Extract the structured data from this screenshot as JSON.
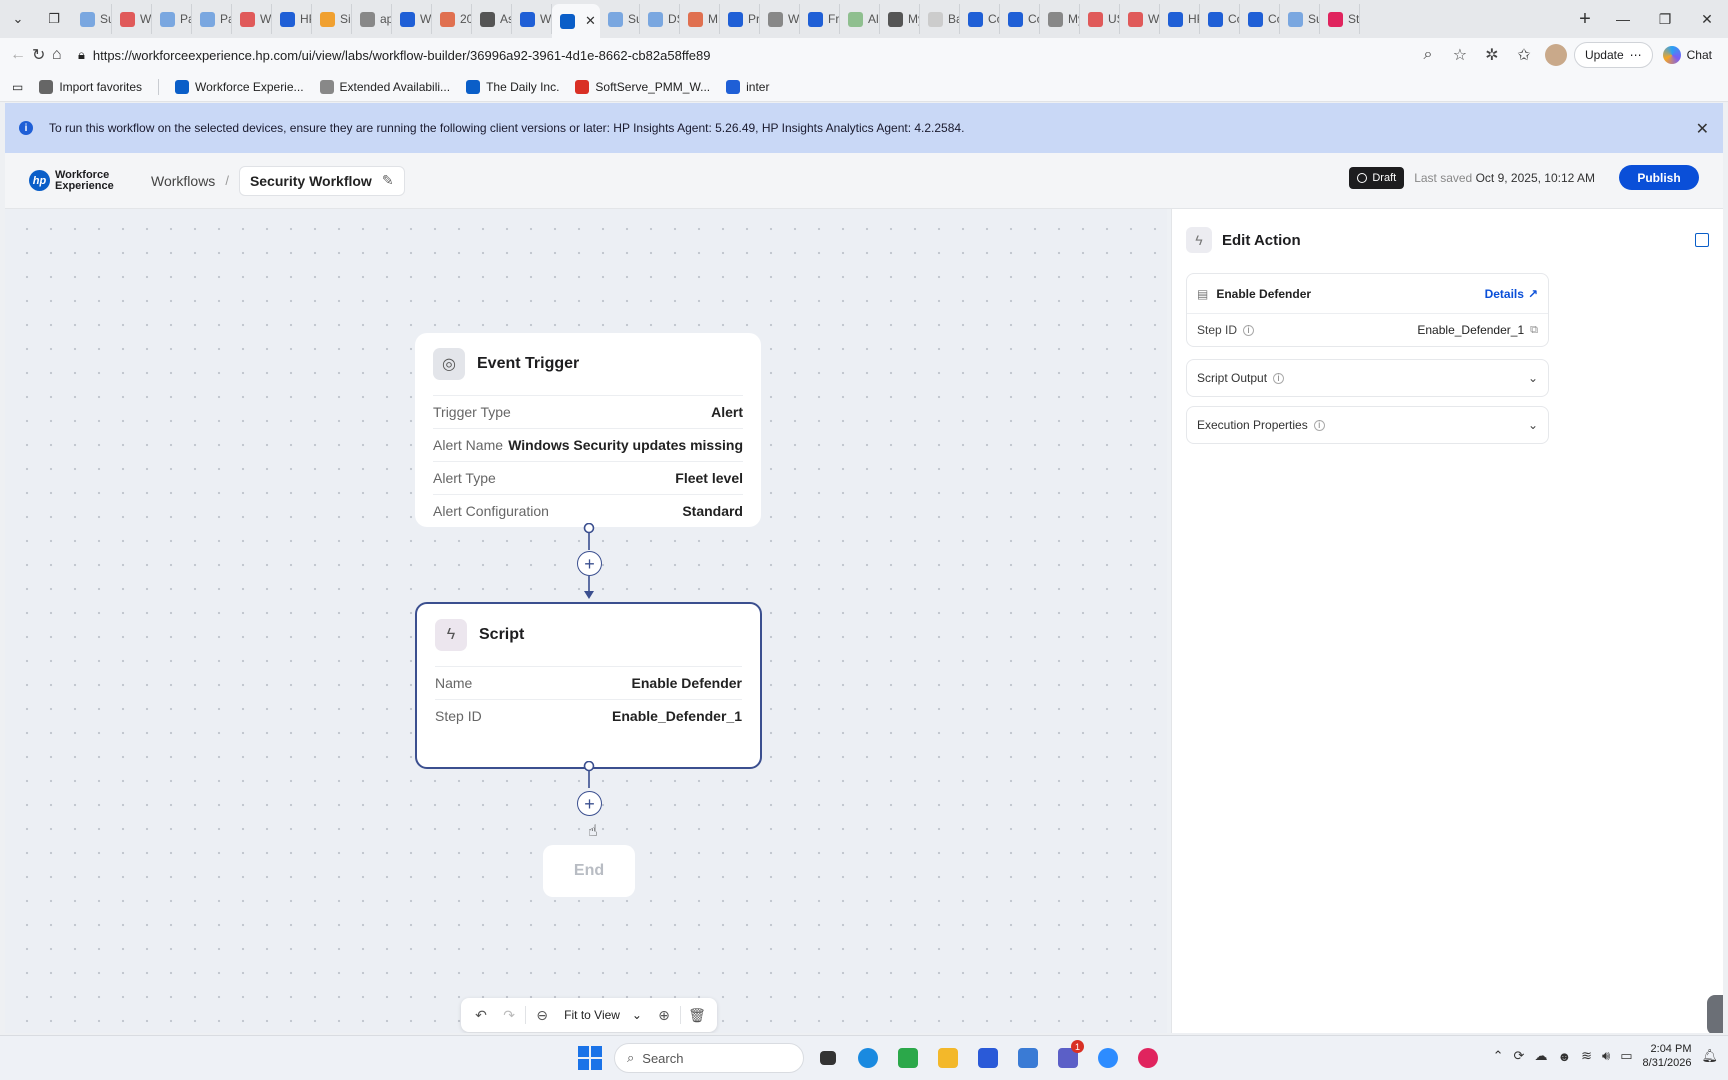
{
  "browser": {
    "tabs": [
      {
        "label": "Sur",
        "color": "#7aa7e0"
      },
      {
        "label": "WX",
        "color": "#e05a5a"
      },
      {
        "label": "Par",
        "color": "#7aa7e0"
      },
      {
        "label": "Par",
        "color": "#7aa7e0"
      },
      {
        "label": "WX",
        "color": "#e05a5a"
      },
      {
        "label": "HP",
        "color": "#1f5fd6"
      },
      {
        "label": "Sig",
        "color": "#f0a030"
      },
      {
        "label": "ap",
        "color": "#888888"
      },
      {
        "label": "Wc",
        "color": "#1f5fd6"
      },
      {
        "label": "20",
        "color": "#e07050"
      },
      {
        "label": "As",
        "color": "#555555"
      },
      {
        "label": "Wc",
        "color": "#1f5fd6"
      }
    ],
    "active_tab": {
      "label": "",
      "color": "#0a5ec8"
    },
    "tabs_right": [
      {
        "label": "Sur",
        "color": "#7aa7e0"
      },
      {
        "label": "DS",
        "color": "#7aa7e0"
      },
      {
        "label": "MF",
        "color": "#e07050"
      },
      {
        "label": "Prc",
        "color": "#1f5fd6"
      },
      {
        "label": "WX",
        "color": "#888888"
      },
      {
        "label": "Fric",
        "color": "#1f5fd6"
      },
      {
        "label": "Alic",
        "color": "#8fbf8f"
      },
      {
        "label": "My",
        "color": "#555555"
      },
      {
        "label": "Bac",
        "color": "#cccccc"
      },
      {
        "label": "Co",
        "color": "#1f5fd6"
      },
      {
        "label": "Co",
        "color": "#1f5fd6"
      },
      {
        "label": "My",
        "color": "#888888"
      },
      {
        "label": "US",
        "color": "#e05a5a"
      },
      {
        "label": "WX",
        "color": "#e05a5a"
      },
      {
        "label": "HP",
        "color": "#1f5fd6"
      },
      {
        "label": "Co",
        "color": "#1f5fd6"
      },
      {
        "label": "Co",
        "color": "#1f5fd6"
      },
      {
        "label": "Sur",
        "color": "#7aa7e0"
      },
      {
        "label": "Sto",
        "color": "#e0245e"
      }
    ],
    "url": "https://workforceexperience.hp.com/ui/view/labs/workflow-builder/36996a92-3961-4d1e-8662-cb82a58ffe89",
    "update_label": "Update",
    "chat_label": "Chat",
    "bookmarks": [
      {
        "label": "Import favorites",
        "color": "#666666"
      },
      {
        "label": "Workforce Experie...",
        "color": "#0a5ec8"
      },
      {
        "label": "Extended Availabili...",
        "color": "#888888"
      },
      {
        "label": "The Daily Inc.",
        "color": "#0a5ec8"
      },
      {
        "label": "SoftServe_PMM_W...",
        "color": "#d93025"
      },
      {
        "label": "inter",
        "color": "#1f5fd6"
      }
    ]
  },
  "banner": {
    "text": "To run this workflow on the selected devices, ensure they are running the following client versions or later: HP Insights Agent: 5.26.49, HP Insights Analytics Agent: 4.2.2584."
  },
  "header": {
    "brand_line1": "Workforce",
    "brand_line2": "Experience",
    "breadcrumb_root": "Workflows",
    "breadcrumb_sep": "/",
    "workflow_name": "Security Workflow",
    "status": "Draft",
    "last_saved_prefix": "Last saved",
    "last_saved_time": "Oct 9, 2025, 10:12 AM",
    "publish_label": "Publish"
  },
  "canvas": {
    "trigger": {
      "title": "Event Trigger",
      "rows": [
        {
          "label": "Trigger Type",
          "value": "Alert"
        },
        {
          "label": "Alert Name",
          "value": "Windows Security updates missing"
        },
        {
          "label": "Alert Type",
          "value": "Fleet level"
        },
        {
          "label": "Alert Configuration",
          "value": "Standard"
        }
      ]
    },
    "script": {
      "title": "Script",
      "rows": [
        {
          "label": "Name",
          "value": "Enable Defender"
        },
        {
          "label": "Step ID",
          "value": "Enable_Defender_1"
        }
      ]
    },
    "end_label": "End",
    "zoom_label": "Fit to View"
  },
  "panel": {
    "title": "Edit Action",
    "action_name": "Enable Defender",
    "details_label": "Details",
    "step_id_label": "Step ID",
    "step_id_value": "Enable_Defender_1",
    "script_output_label": "Script Output",
    "execution_properties_label": "Execution Properties"
  },
  "taskbar": {
    "search_placeholder": "Search",
    "time": "2:04 PM",
    "date": "8/31/2026",
    "badge_count": "1"
  }
}
